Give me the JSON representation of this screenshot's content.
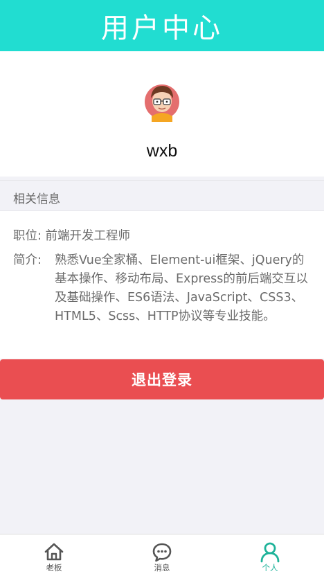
{
  "header": {
    "title": "用户中心"
  },
  "profile": {
    "username": "wxb",
    "avatar_icon": "avatar-icon"
  },
  "section": {
    "title": "相关信息"
  },
  "info": {
    "job_label": "职位:",
    "job_value": "前端开发工程师",
    "intro_label": "简介:",
    "intro_value": "熟悉Vue全家桶、Element-ui框架、jQuery的基本操作、移动布局、Express的前后端交互以及基础操作、ES6语法、JavaScript、CSS3、HTML5、Scss、HTTP协议等专业技能。"
  },
  "logout": {
    "label": "退出登录"
  },
  "tabbar": {
    "items": [
      {
        "label": "老板",
        "icon": "home-icon"
      },
      {
        "label": "消息",
        "icon": "message-icon"
      },
      {
        "label": "个人",
        "icon": "user-icon"
      }
    ]
  },
  "colors": {
    "header": "#21ddd1",
    "logout": "#ea4e51",
    "tab_active": "#1fb39a",
    "background": "#f2f2f7"
  }
}
